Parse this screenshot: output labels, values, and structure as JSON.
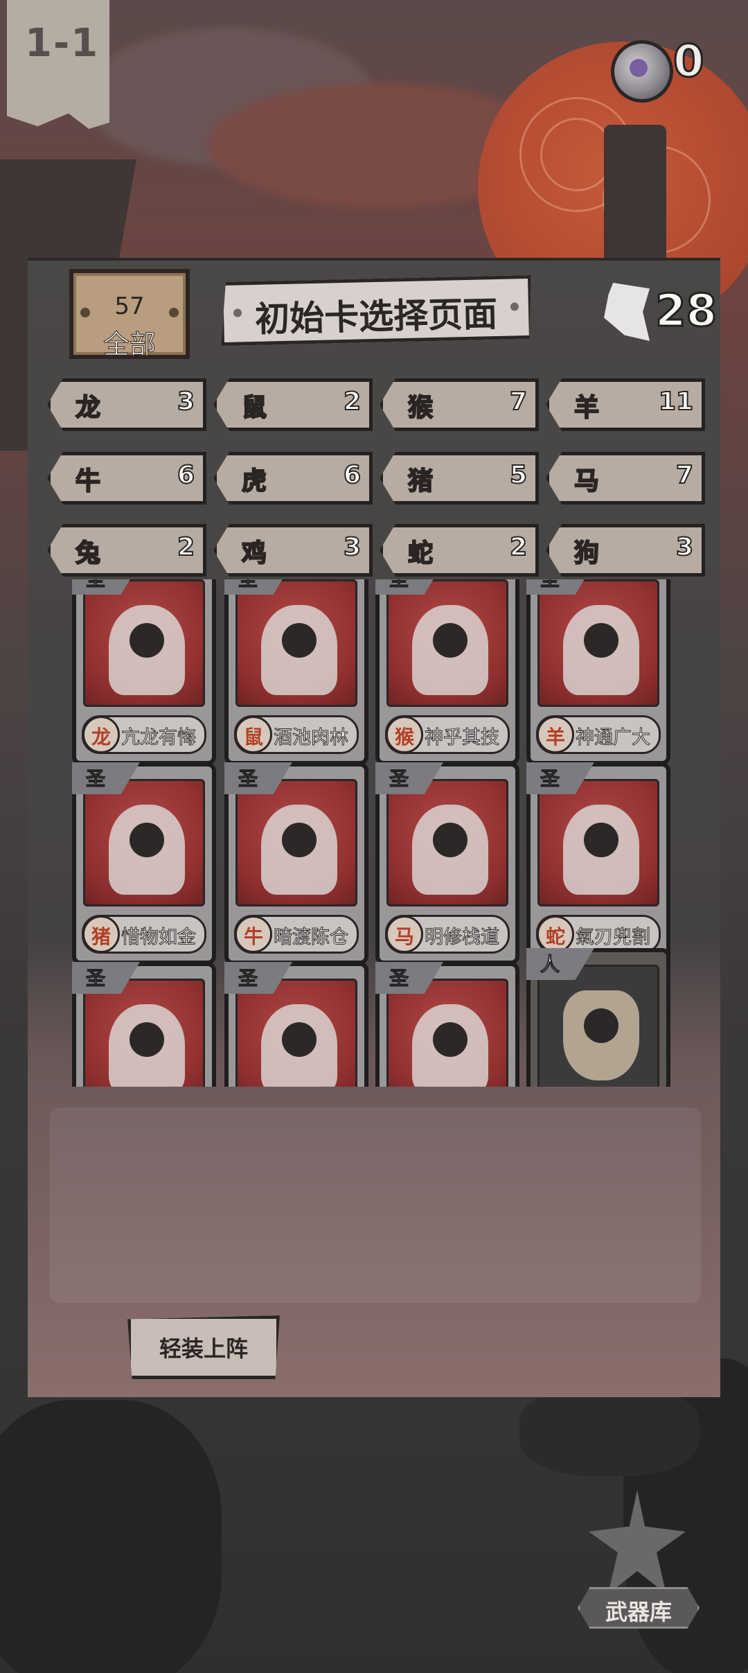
{
  "hud": {
    "level": "1-1",
    "gem_count": "0",
    "tooth_count": "28"
  },
  "header": {
    "total_count": "57",
    "filter_label": "全部",
    "title": "初始卡选择页面"
  },
  "zodiac_filters": [
    {
      "name": "龙",
      "count": "3"
    },
    {
      "name": "鼠",
      "count": "2"
    },
    {
      "name": "猴",
      "count": "7"
    },
    {
      "name": "羊",
      "count": "11"
    },
    {
      "name": "牛",
      "count": "6"
    },
    {
      "name": "虎",
      "count": "6"
    },
    {
      "name": "猪",
      "count": "5"
    },
    {
      "name": "马",
      "count": "7"
    },
    {
      "name": "兔",
      "count": "2"
    },
    {
      "name": "鸡",
      "count": "3"
    },
    {
      "name": "蛇",
      "count": "2"
    },
    {
      "name": "狗",
      "count": "3"
    }
  ],
  "cards": [
    {
      "rank": "圣",
      "zodiac": "龙",
      "name": "亢龙有悔"
    },
    {
      "rank": "圣",
      "zodiac": "鼠",
      "name": "酒池肉林"
    },
    {
      "rank": "圣",
      "zodiac": "猴",
      "name": "神乎其技"
    },
    {
      "rank": "圣",
      "zodiac": "羊",
      "name": "神通广大"
    },
    {
      "rank": "圣",
      "zodiac": "猪",
      "name": "惜物如金"
    },
    {
      "rank": "圣",
      "zodiac": "牛",
      "name": "暗渡陈仓"
    },
    {
      "rank": "圣",
      "zodiac": "马",
      "name": "明修栈道"
    },
    {
      "rank": "圣",
      "zodiac": "蛇",
      "name": "氣刃兜割"
    },
    {
      "rank": "圣",
      "zodiac": "",
      "name": ""
    },
    {
      "rank": "圣",
      "zodiac": "",
      "name": ""
    },
    {
      "rank": "圣",
      "zodiac": "",
      "name": ""
    },
    {
      "rank": "人",
      "zodiac": "",
      "name": ""
    }
  ],
  "actions": {
    "equip_button": "轻装上阵",
    "armory_label": "武器库"
  },
  "colors": {
    "card_art_red": "#9b3634",
    "rank_badge_gray": "#7b7b80",
    "panel_dark": "#4a4747",
    "zodiac_badge_text": "#b24027"
  }
}
